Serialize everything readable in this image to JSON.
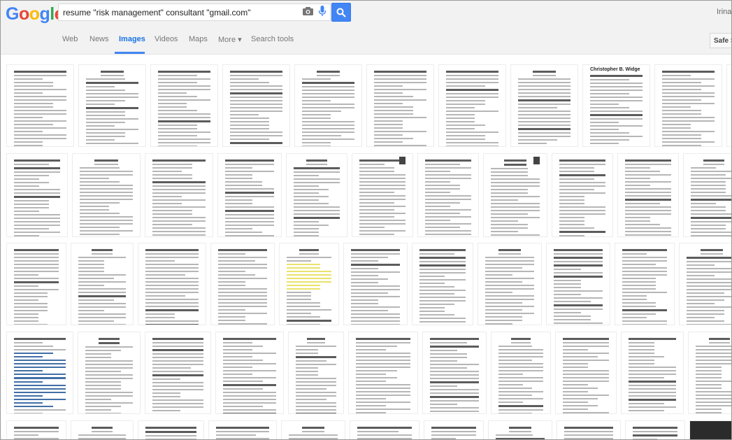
{
  "logo": {
    "letters": [
      "G",
      "o",
      "o",
      "g",
      "l",
      "e"
    ],
    "colors": [
      "#4285f4",
      "#ea4335",
      "#fbbc05",
      "#4285f4",
      "#34a853",
      "#ea4335"
    ]
  },
  "search": {
    "query": "resume \"risk management\" consultant \"gmail.com\""
  },
  "user": {
    "name": "Irina"
  },
  "tabs": [
    {
      "label": "Web"
    },
    {
      "label": "News"
    },
    {
      "label": "Images",
      "active": true
    },
    {
      "label": "Videos"
    },
    {
      "label": "Maps"
    },
    {
      "label": "More ▾"
    },
    {
      "label": "Search tools"
    }
  ],
  "safe_search": {
    "label": "Safe Se"
  },
  "colors": {
    "accent": "#4285f4",
    "tab_active": "#1a73e8",
    "header_bg": "#f2f2f2"
  },
  "thumbnail_texts": {
    "christopher": "Christopher B. Widge"
  },
  "icons": [
    "camera-icon",
    "microphone-icon",
    "magnifier-icon"
  ]
}
